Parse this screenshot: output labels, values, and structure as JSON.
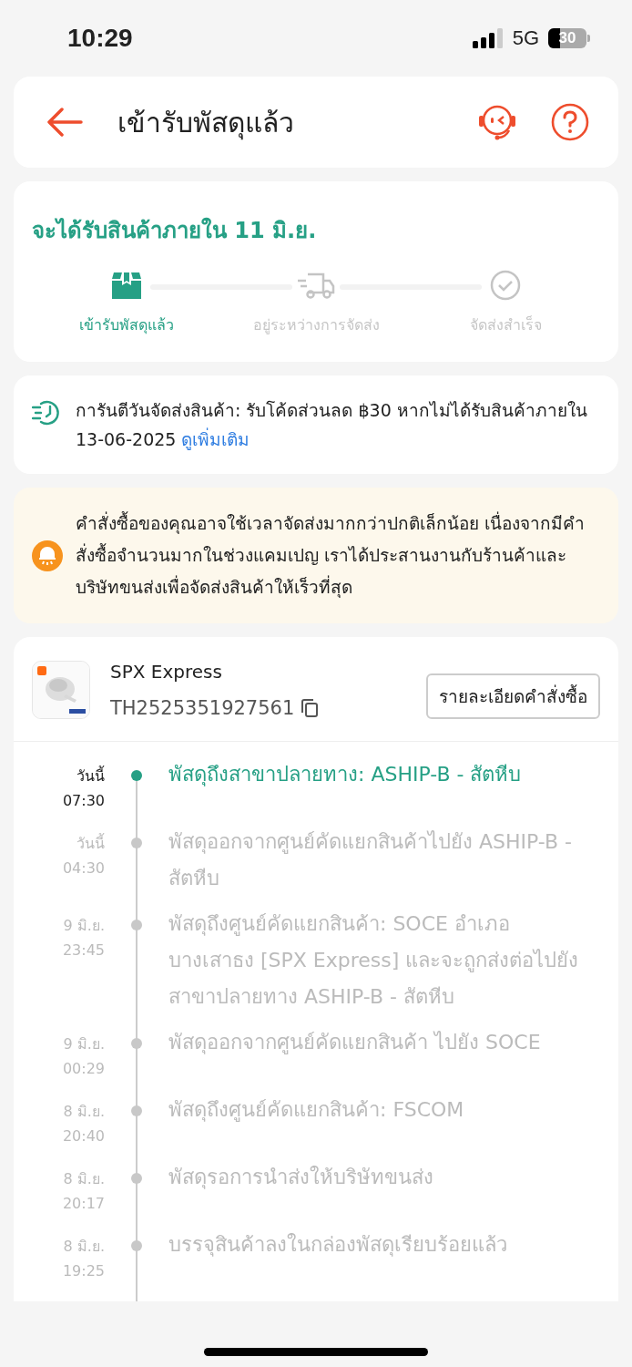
{
  "status_bar": {
    "time": "10:29",
    "network": "5G",
    "battery": "30"
  },
  "header": {
    "title": "เข้ารับพัสดุแล้ว"
  },
  "delivery": {
    "title": "จะได้รับสินค้าภายใน 11 มิ.ย.",
    "steps": [
      {
        "kind": "box",
        "label": "เข้ารับพัสดุแล้ว",
        "done": true
      },
      {
        "kind": "truck",
        "label": "อยู่ระหว่างการจัดส่ง",
        "done": false
      },
      {
        "kind": "check",
        "label": "จัดส่งสำเร็จ",
        "done": false
      }
    ]
  },
  "guarantee": {
    "text": "การันตีวันจัดส่งสินค้า: รับโค้ดส่วนลด ฿30 หากไม่ได้รับสินค้าภายใน 13-06-2025",
    "link": "ดูเพิ่มเติม"
  },
  "notice": {
    "text": "คำสั่งซื้อของคุณอาจใช้เวลาจัดส่งมากกว่าปกติเล็กน้อย เนื่องจากมีคำสั่งซื้อจำนวนมากในช่วงแคมเปญ เราได้ประสานงานกับร้านค้าและบริษัทขนส่งเพื่อจัดส่งสินค้าให้เร็วที่สุด"
  },
  "shipment": {
    "carrier": "SPX Express",
    "tracking": "TH2525351927561",
    "button": "รายละเอียดคำสั่งซื้อ",
    "events": [
      {
        "date": "วันนี้",
        "time": "07:30",
        "text": "พัสดุถึงสาขาปลายทาง: ASHIP-B - สัตหีบ",
        "active": true
      },
      {
        "date": "วันนี้",
        "time": "04:30",
        "text": "พัสดุออกจากศูนย์คัดแยกสินค้าไปยัง ASHIP-B - สัตหีบ",
        "active": false
      },
      {
        "date": "9 มิ.ย.",
        "time": "23:45",
        "text": "พัสดุถึงศูนย์คัดแยกสินค้า: SOCE อำเภอบางเสาธง [SPX Express] และจะถูกส่งต่อไปยังสาขาปลายทาง ASHIP-B - สัตหีบ",
        "active": false
      },
      {
        "date": "9 มิ.ย.",
        "time": "00:29",
        "text": "พัสดุออกจากศูนย์คัดแยกสินค้า ไปยัง SOCE",
        "active": false
      },
      {
        "date": "8 มิ.ย.",
        "time": "20:40",
        "text": "พัสดุถึงศูนย์คัดแยกสินค้า: FSCOM",
        "active": false
      },
      {
        "date": "8 มิ.ย.",
        "time": "20:17",
        "text": "พัสดุรอการนำส่งให้บริษัทขนส่ง",
        "active": false
      },
      {
        "date": "8 มิ.ย.",
        "time": "19:25",
        "text": "บรรจุสินค้าลงในกล่องพัสดุเรียบร้อยแล้ว",
        "active": false
      }
    ]
  }
}
